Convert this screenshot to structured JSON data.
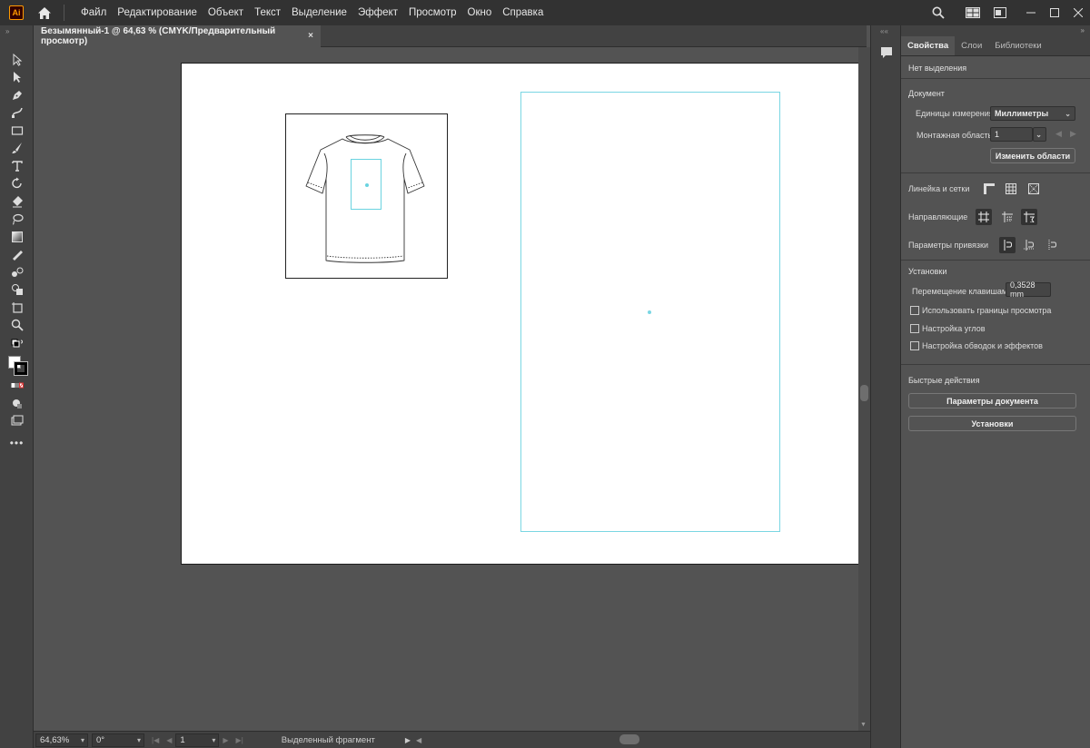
{
  "app": {
    "logo_text": "Ai",
    "accent_color": "#ff9a00"
  },
  "menu": {
    "items": [
      "Файл",
      "Редактирование",
      "Объект",
      "Текст",
      "Выделение",
      "Эффект",
      "Просмотр",
      "Окно",
      "Справка"
    ]
  },
  "document_tab": {
    "title": "Безымянный-1 @ 64,63 % (CMYK/Предварительный просмотр)",
    "close": "×"
  },
  "properties": {
    "tabs": [
      "Свойства",
      "Слои",
      "Библиотеки"
    ],
    "no_selection": "Нет выделения",
    "document_title": "Документ",
    "units_label": "Единицы измерения:",
    "units_value": "Миллиметры",
    "artboard_label": "Монтажная область:",
    "artboard_value": "1",
    "edit_artboards_button": "Изменить области",
    "rulers_label": "Линейка и сетки",
    "guides_label": "Направляющие",
    "snap_label": "Параметры привязки",
    "preferences_title": "Установки",
    "keyboard_increment_label": "Перемещение клавишами:",
    "keyboard_increment_value": "0,3528 mm",
    "checkboxes": [
      "Использовать границы просмотра",
      "Настройка углов",
      "Настройка обводок и эффектов"
    ],
    "quick_actions_title": "Быстрые действия",
    "document_setup_button": "Параметры документа",
    "preferences_button": "Установки"
  },
  "statusbar": {
    "zoom": "64,63%",
    "rotation": "0°",
    "artboard": "1",
    "status_text": "Выделенный фрагмент"
  }
}
